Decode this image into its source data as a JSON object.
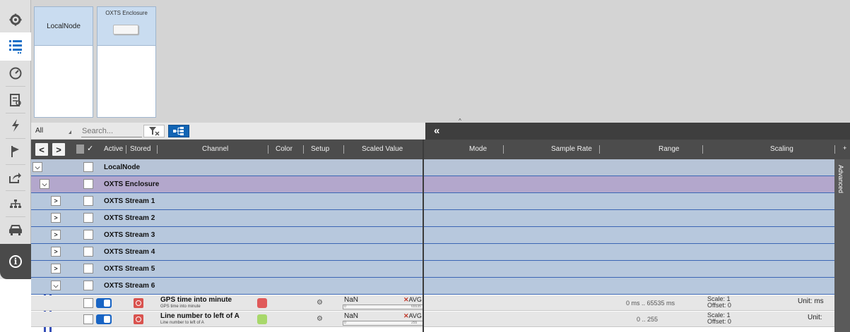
{
  "left_rail": {
    "icons": [
      "gear-icon",
      "channel-list-icon",
      "gauge-icon",
      "report-icon",
      "lightning-icon",
      "flag-icon",
      "export-icon",
      "network-icon",
      "car-icon",
      "info-icon"
    ],
    "info_glyph": "i"
  },
  "nodes": {
    "local_node": "LocalNode",
    "enclosure": "OXTS Enclosure"
  },
  "filter": {
    "all_label": "All",
    "search_placeholder": "Search..."
  },
  "toolbar": {
    "collapse_glyph": "«",
    "expand_up_glyph": "^"
  },
  "columns": {
    "active": "Active",
    "stored": "Stored",
    "channel": "Channel",
    "color": "Color",
    "setup": "Setup",
    "scaled_value": "Scaled Value",
    "mode": "Mode",
    "sample_rate": "Sample Rate",
    "range": "Range",
    "scaling": "Scaling",
    "add": "+"
  },
  "nav": {
    "back": "<",
    "forward": ">",
    "check_all": "✓"
  },
  "tree": {
    "local_node": "LocalNode",
    "enclosure": "OXTS Enclosure",
    "streams": [
      "OXTS Stream 1",
      "OXTS Stream 2",
      "OXTS Stream 3",
      "OXTS Stream 4",
      "OXTS Stream 5",
      "OXTS Stream 6"
    ]
  },
  "channels": [
    {
      "name": "GPS time into minute",
      "sub": "GPS time into minute",
      "color": "#e05a5a",
      "value": "NaN",
      "avg": "AVG",
      "min": "0",
      "max": "65535",
      "range": "0 ms .. 65535 ms",
      "scale": "Scale: 1",
      "offset": "Offset: 0",
      "unit": "Unit: ms"
    },
    {
      "name": "Line number to left of A",
      "sub": "Line number to left of A",
      "color": "#a8d86b",
      "value": "NaN",
      "avg": "AVG",
      "min": "0",
      "max": "255",
      "range": "0 .. 255",
      "scale": "Scale: 1",
      "offset": "Offset: 0",
      "unit": "Unit:"
    }
  ],
  "side_panel": {
    "label": "Advanced"
  }
}
